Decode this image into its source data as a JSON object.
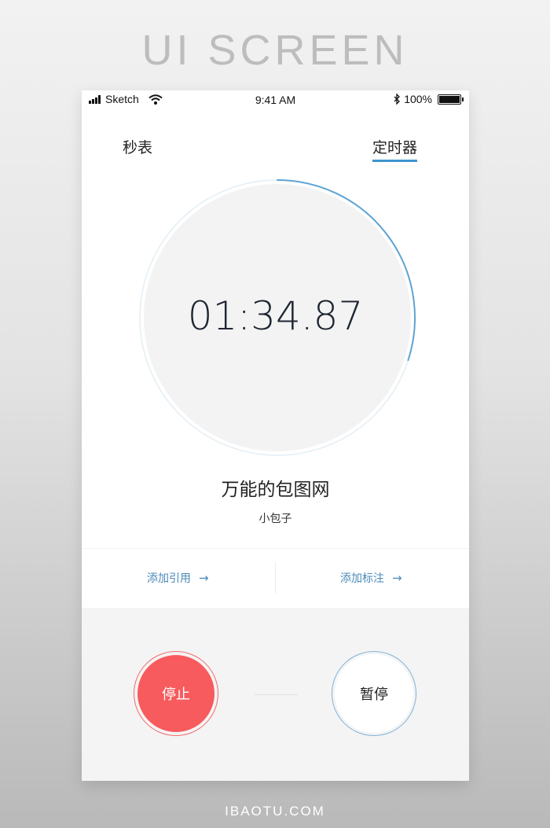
{
  "header": {
    "title": "UI SCREEN"
  },
  "footer": {
    "brand": "IBAOTU.COM"
  },
  "status_bar": {
    "carrier": "Sketch",
    "time": "9:41 AM",
    "battery": "100%"
  },
  "tabs": [
    {
      "label": "秒表",
      "active": false
    },
    {
      "label": "定时器",
      "active": true
    }
  ],
  "timer": {
    "time": "01:34.87",
    "progress": 0.3,
    "name": "万能的包图网",
    "author": "小包子"
  },
  "actions": {
    "add_reference": "添加引用",
    "add_note": "添加标注"
  },
  "controls": {
    "stop": "停止",
    "pause": "暂停"
  },
  "colors": {
    "accent": "#3e95cf",
    "stop": "#f75b5d",
    "link": "#4b8ab8"
  }
}
